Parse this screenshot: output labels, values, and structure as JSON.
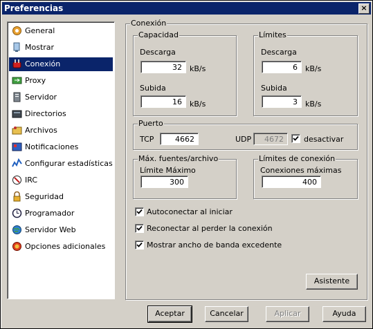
{
  "window": {
    "title": "Preferencias",
    "close": "×"
  },
  "sidebar": {
    "items": [
      {
        "label": "General",
        "icon": "general-icon"
      },
      {
        "label": "Mostrar",
        "icon": "display-icon"
      },
      {
        "label": "Conexión",
        "icon": "connection-icon",
        "selected": true
      },
      {
        "label": "Proxy",
        "icon": "proxy-icon"
      },
      {
        "label": "Servidor",
        "icon": "server-icon"
      },
      {
        "label": "Directorios",
        "icon": "folders-icon"
      },
      {
        "label": "Archivos",
        "icon": "files-icon"
      },
      {
        "label": "Notificaciones",
        "icon": "notifications-icon"
      },
      {
        "label": "Configurar estadísticas",
        "icon": "statistics-icon"
      },
      {
        "label": "IRC",
        "icon": "irc-icon"
      },
      {
        "label": "Seguridad",
        "icon": "security-icon"
      },
      {
        "label": "Programador",
        "icon": "scheduler-icon"
      },
      {
        "label": "Servidor Web",
        "icon": "webserver-icon"
      },
      {
        "label": "Opciones adicionales",
        "icon": "extra-options-icon"
      }
    ]
  },
  "main": {
    "title": "Conexión",
    "capacity": {
      "title": "Capacidad",
      "download_label": "Descarga",
      "download_value": "32",
      "upload_label": "Subida",
      "upload_value": "16",
      "unit": "kB/s"
    },
    "limits": {
      "title": "Límites",
      "download_label": "Descarga",
      "download_value": "6",
      "upload_label": "Subida",
      "upload_value": "3",
      "unit": "kB/s"
    },
    "port": {
      "title": "Puerto",
      "tcp_label": "TCP",
      "tcp_value": "4662",
      "udp_label": "UDP",
      "udp_value": "4672",
      "disable_label": "desactivar",
      "disable_checked": true
    },
    "sources": {
      "title": "Máx. fuentes/archivo",
      "label": "Límite Máximo",
      "value": "300"
    },
    "connections": {
      "title": "Límites de conexión",
      "label": "Conexiones máximas",
      "value": "400"
    },
    "options": [
      {
        "label": "Autoconectar al iniciar",
        "checked": true
      },
      {
        "label": "Reconectar al perder la conexión",
        "checked": true
      },
      {
        "label": "Mostrar ancho de banda excedente",
        "checked": true
      }
    ],
    "wizard_button": "Asistente"
  },
  "footer": {
    "accept": "Aceptar",
    "cancel": "Cancelar",
    "apply": "Aplicar",
    "help": "Ayuda"
  }
}
